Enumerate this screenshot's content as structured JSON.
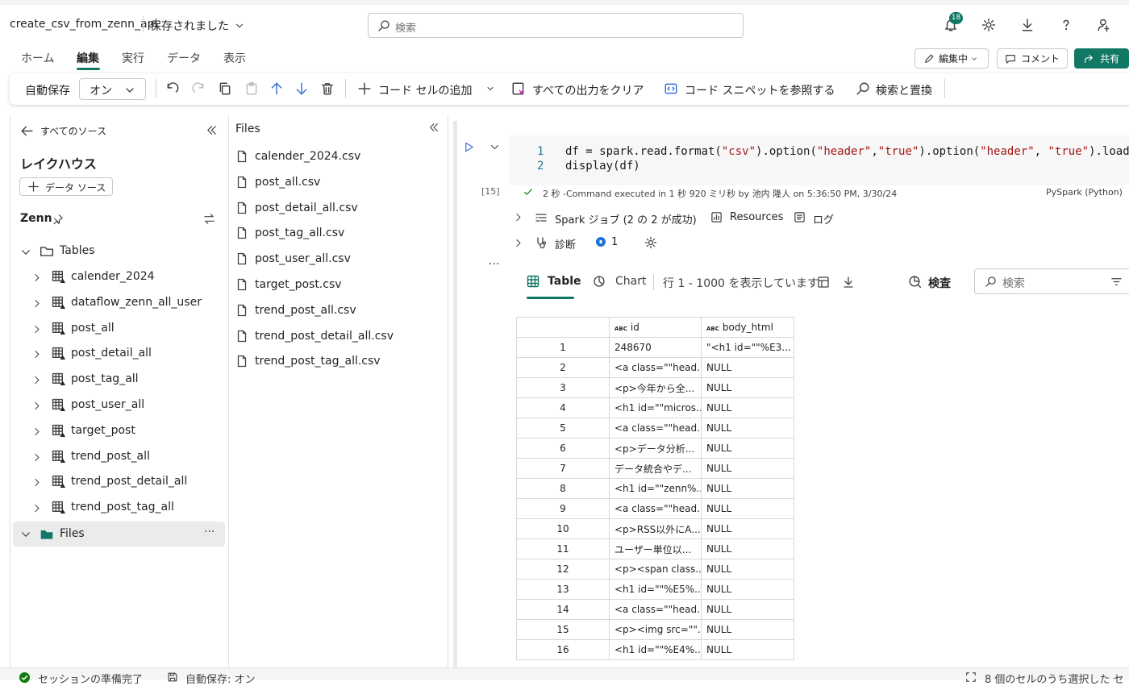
{
  "topbar": {
    "notebook_name": "create_csv_from_zenn_api",
    "save_status": "保存されました",
    "search_placeholder": "検索",
    "notification_count": "18"
  },
  "menu_tabs": [
    "ホーム",
    "編集",
    "実行",
    "データ",
    "表示"
  ],
  "active_tab": "編集",
  "right_actions": {
    "mode": "編集中",
    "comment": "コメント",
    "share": "共有"
  },
  "toolbar": {
    "autosave_label": "自動保存",
    "autosave_value": "オン",
    "add_code_cell": "コード セルの追加",
    "clear_outputs": "すべての出力をクリア",
    "browse_snippets": "コード スニペットを参照する",
    "find_replace": "検索と置換"
  },
  "explorer": {
    "back_label": "すべてのソース",
    "section_title": "レイクハウス",
    "add_source_label": "データ ソース",
    "lakehouse_name": "Zenn",
    "tables_label": "Tables",
    "tables": [
      "calender_2024",
      "dataflow_zenn_all_user",
      "post_all",
      "post_detail_all",
      "post_tag_all",
      "post_user_all",
      "target_post",
      "trend_post_all",
      "trend_post_detail_all",
      "trend_post_tag_all"
    ],
    "files_label": "Files"
  },
  "files_panel": {
    "title": "Files",
    "files": [
      "calender_2024.csv",
      "post_all.csv",
      "post_detail_all.csv",
      "post_tag_all.csv",
      "post_user_all.csv",
      "target_post.csv",
      "trend_post_all.csv",
      "trend_post_detail_all.csv",
      "trend_post_tag_all.csv"
    ]
  },
  "cell": {
    "line_numbers": [
      "1",
      "2"
    ],
    "line1_prefix": "df = spark.read.format(",
    "line1_s1": "\"csv\"",
    "line1_mid1": ").option(",
    "line1_s2": "\"header\"",
    "line1_comma": ",",
    "line1_s3": "\"true\"",
    "line1_mid2": ").option(",
    "line1_s4": "\"header\"",
    "line1_comma2": ", ",
    "line1_s5": "\"true\"",
    "line1_suffix": ").load",
    "line2": "display(df)",
    "exec_count": "[15]",
    "exec_info": "2 秒 -Command executed in 1 秒 920 ミリ秒 by 池内 隆人 on 5:36:50 PM, 3/30/24",
    "language": "PySpark (Python)",
    "spark_jobs": "Spark ジョブ (2 の 2 が成功)",
    "resources": "Resources",
    "log": "ログ",
    "diagnostics": "診断",
    "diag_count": "1"
  },
  "output": {
    "tab_table": "Table",
    "tab_chart": "Chart",
    "rows_info": "行 1 - 1000 を表示しています",
    "inspect": "検査",
    "search_placeholder": "検索",
    "type_badge": "ABC",
    "columns": [
      "id",
      "body_html"
    ],
    "rows": [
      [
        "1",
        "248670",
        "\"<h1 id=\"\"%E3..."
      ],
      [
        "2",
        "<a class=\"\"head...",
        "NULL"
      ],
      [
        "3",
        "<p>今年から全...",
        "NULL"
      ],
      [
        "4",
        "<h1 id=\"\"micros...",
        "NULL"
      ],
      [
        "5",
        "<a class=\"\"head...",
        "NULL"
      ],
      [
        "6",
        "<p>データ分析...",
        "NULL"
      ],
      [
        "7",
        "データ統合やデ...",
        "NULL"
      ],
      [
        "8",
        "<h1 id=\"\"zenn%...",
        "NULL"
      ],
      [
        "9",
        "<a class=\"\"head...",
        "NULL"
      ],
      [
        "10",
        "<p>RSS以外にA...",
        "NULL"
      ],
      [
        "11",
        "ユーザー単位以...",
        "NULL"
      ],
      [
        "12",
        "<p><span class...",
        "NULL"
      ],
      [
        "13",
        "<h1 id=\"\"%E5%...",
        "NULL"
      ],
      [
        "14",
        "<a class=\"\"head...",
        "NULL"
      ],
      [
        "15",
        "<p><img src=\"\"...",
        "NULL"
      ],
      [
        "16",
        "<h1 id=\"\"%E4%...",
        "NULL"
      ]
    ]
  },
  "statusbar": {
    "session": "セッションの準備完了",
    "autosave": "自動保存: オン",
    "selection": "8 個のセルのうち選択した セ"
  },
  "colors": {
    "accent": "#117865",
    "share_bg": "#117865",
    "badge": "#117865"
  }
}
